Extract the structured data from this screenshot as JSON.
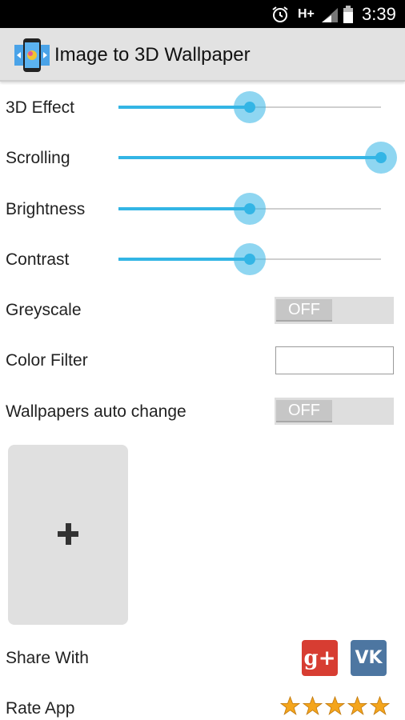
{
  "status_bar": {
    "network": "H+",
    "time": "3:39"
  },
  "app_bar": {
    "title": "Image to 3D Wallpaper"
  },
  "settings": {
    "effect_3d": {
      "label": "3D Effect",
      "value_fraction": 0.5
    },
    "scrolling": {
      "label": "Scrolling",
      "value_fraction": 1.0
    },
    "brightness": {
      "label": "Brightness",
      "value_fraction": 0.5
    },
    "contrast": {
      "label": "Contrast",
      "value_fraction": 0.5
    },
    "greyscale": {
      "label": "Greyscale",
      "state": "OFF"
    },
    "color_filter": {
      "label": "Color Filter"
    },
    "auto_change": {
      "label": "Wallpapers auto change",
      "state": "OFF"
    }
  },
  "share": {
    "label": "Share With",
    "gplus_text": "g+",
    "vk_text": "VK"
  },
  "rate": {
    "label": "Rate App",
    "stars": 5
  },
  "colors": {
    "accent": "#33b5e5",
    "star": "#f4a51c"
  }
}
